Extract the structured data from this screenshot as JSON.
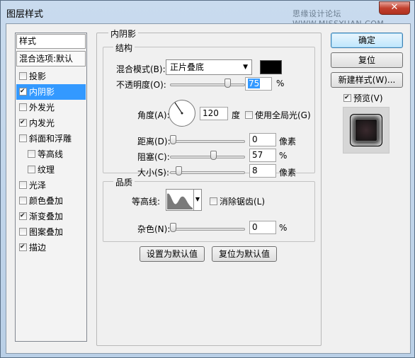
{
  "window": {
    "title": "图层样式",
    "watermark": "思缘设计论坛 WWW.MISSYUAN.COM",
    "close_label": "✕"
  },
  "styles_list": {
    "header": "样式",
    "blend_options": "混合选项:默认",
    "items": [
      {
        "label": "投影",
        "checked": false,
        "selected": false,
        "indent": false
      },
      {
        "label": "内阴影",
        "checked": true,
        "selected": true,
        "indent": false
      },
      {
        "label": "外发光",
        "checked": false,
        "selected": false,
        "indent": false
      },
      {
        "label": "内发光",
        "checked": true,
        "selected": false,
        "indent": false
      },
      {
        "label": "斜面和浮雕",
        "checked": false,
        "selected": false,
        "indent": false
      },
      {
        "label": "等高线",
        "checked": false,
        "selected": false,
        "indent": true
      },
      {
        "label": "纹理",
        "checked": false,
        "selected": false,
        "indent": true
      },
      {
        "label": "光泽",
        "checked": false,
        "selected": false,
        "indent": false
      },
      {
        "label": "颜色叠加",
        "checked": false,
        "selected": false,
        "indent": false
      },
      {
        "label": "渐变叠加",
        "checked": true,
        "selected": false,
        "indent": false
      },
      {
        "label": "图案叠加",
        "checked": false,
        "selected": false,
        "indent": false
      },
      {
        "label": "描边",
        "checked": true,
        "selected": false,
        "indent": false
      }
    ]
  },
  "inner_shadow": {
    "group_title": "内阴影",
    "structure_title": "结构",
    "blend_mode_label": "混合模式(B):",
    "blend_mode_value": "正片叠底",
    "shadow_color": "#000000",
    "opacity_label": "不透明度(O):",
    "opacity_value": "75",
    "opacity_unit": "%",
    "angle_label": "角度(A):",
    "angle_value": "120",
    "angle_unit": "度",
    "global_light_label": "使用全局光(G)",
    "global_light_checked": false,
    "distance_label": "距离(D):",
    "distance_value": "0",
    "distance_unit": "像素",
    "choke_label": "阻塞(C):",
    "choke_value": "57",
    "choke_unit": "%",
    "size_label": "大小(S):",
    "size_value": "8",
    "size_unit": "像素",
    "quality_title": "品质",
    "contour_label": "等高线:",
    "anti_alias_label": "消除锯齿(L)",
    "anti_alias_checked": false,
    "noise_label": "杂色(N):",
    "noise_value": "0",
    "noise_unit": "%",
    "set_default_label": "设置为默认值",
    "reset_default_label": "复位为默认值"
  },
  "actions": {
    "ok_label": "确定",
    "reset_label": "复位",
    "new_style_label": "新建样式(W)...",
    "preview_label": "预览(V)",
    "preview_checked": true
  }
}
